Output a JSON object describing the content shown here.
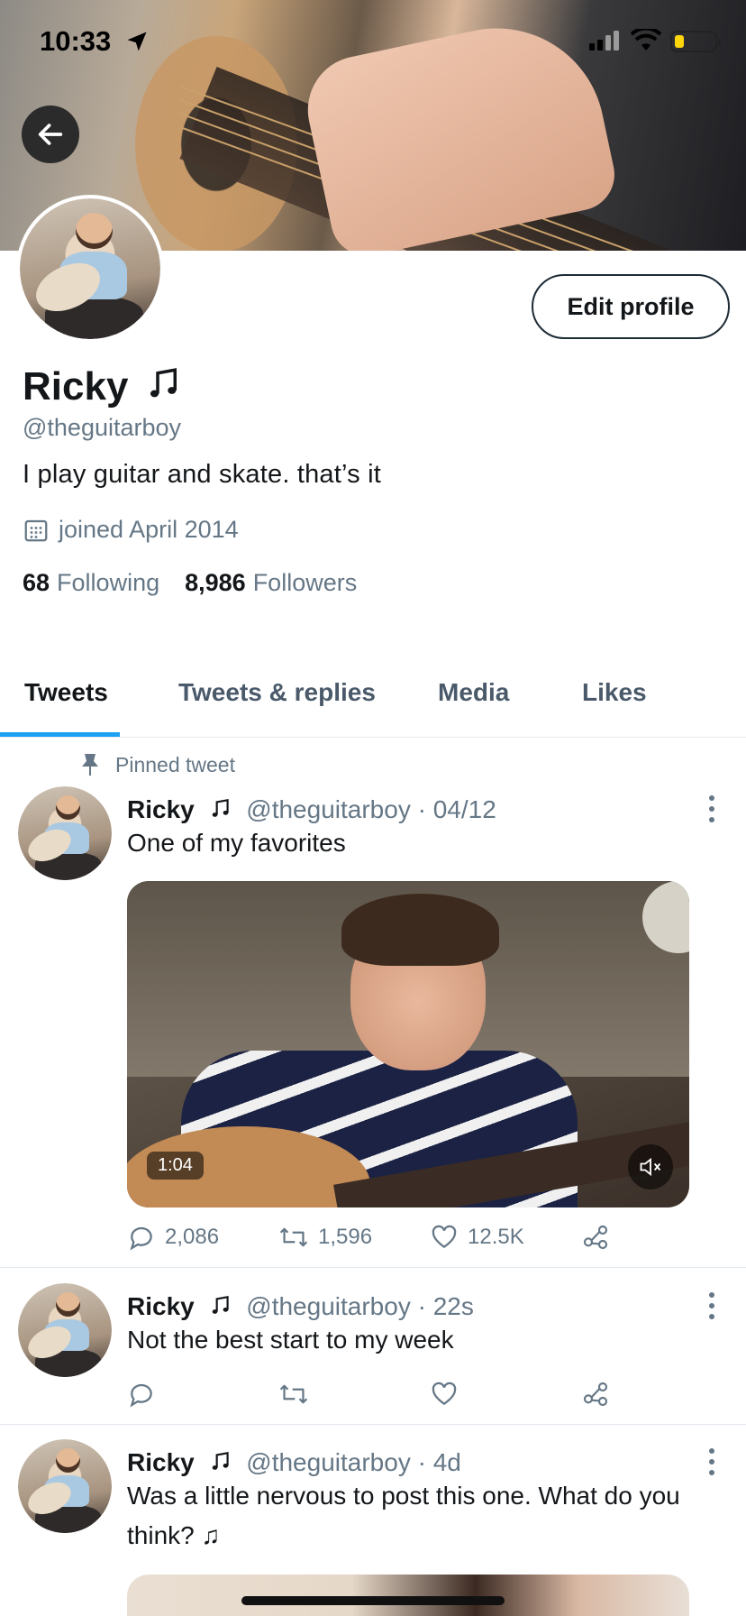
{
  "status_bar": {
    "time": "10:33"
  },
  "profile": {
    "name": "Ricky",
    "handle": "@theguitarboy",
    "bio": "I play guitar and skate. that’s it",
    "joined": "joined April 2014",
    "following_count": "68",
    "following_label": "Following",
    "followers_count": "8,986",
    "followers_label": "Followers",
    "edit_label": "Edit profile"
  },
  "tabs": [
    {
      "label": "Tweets",
      "active": true
    },
    {
      "label": "Tweets & replies",
      "active": false
    },
    {
      "label": "Media",
      "active": false
    },
    {
      "label": "Likes",
      "active": false
    }
  ],
  "pinned_label": "Pinned tweet",
  "tweets": [
    {
      "name": "Ricky",
      "handle": "@theguitarboy",
      "time": "04/12",
      "text": "One of my favorites",
      "video_duration": "1:04",
      "replies": "2,086",
      "retweets": "1,596",
      "likes": "12.5K"
    },
    {
      "name": "Ricky",
      "handle": "@theguitarboy",
      "time": "22s",
      "text": "Not the best start to my week"
    },
    {
      "name": "Ricky",
      "handle": "@theguitarboy",
      "time": "4d",
      "text": "Was a little nervous to post this one. What do you think? ♫"
    }
  ],
  "icons": {
    "back": "arrow-left-icon",
    "music_note": "music-note-icon",
    "calendar": "calendar-icon",
    "pin": "pin-icon",
    "reply": "reply-icon",
    "retweet": "retweet-icon",
    "like": "heart-icon",
    "share": "share-icon",
    "more": "more-vertical-icon",
    "mute": "muted-speaker-icon"
  },
  "colors": {
    "accent": "#1da1f2",
    "secondary_text": "#657786",
    "primary_text": "#14171a"
  }
}
